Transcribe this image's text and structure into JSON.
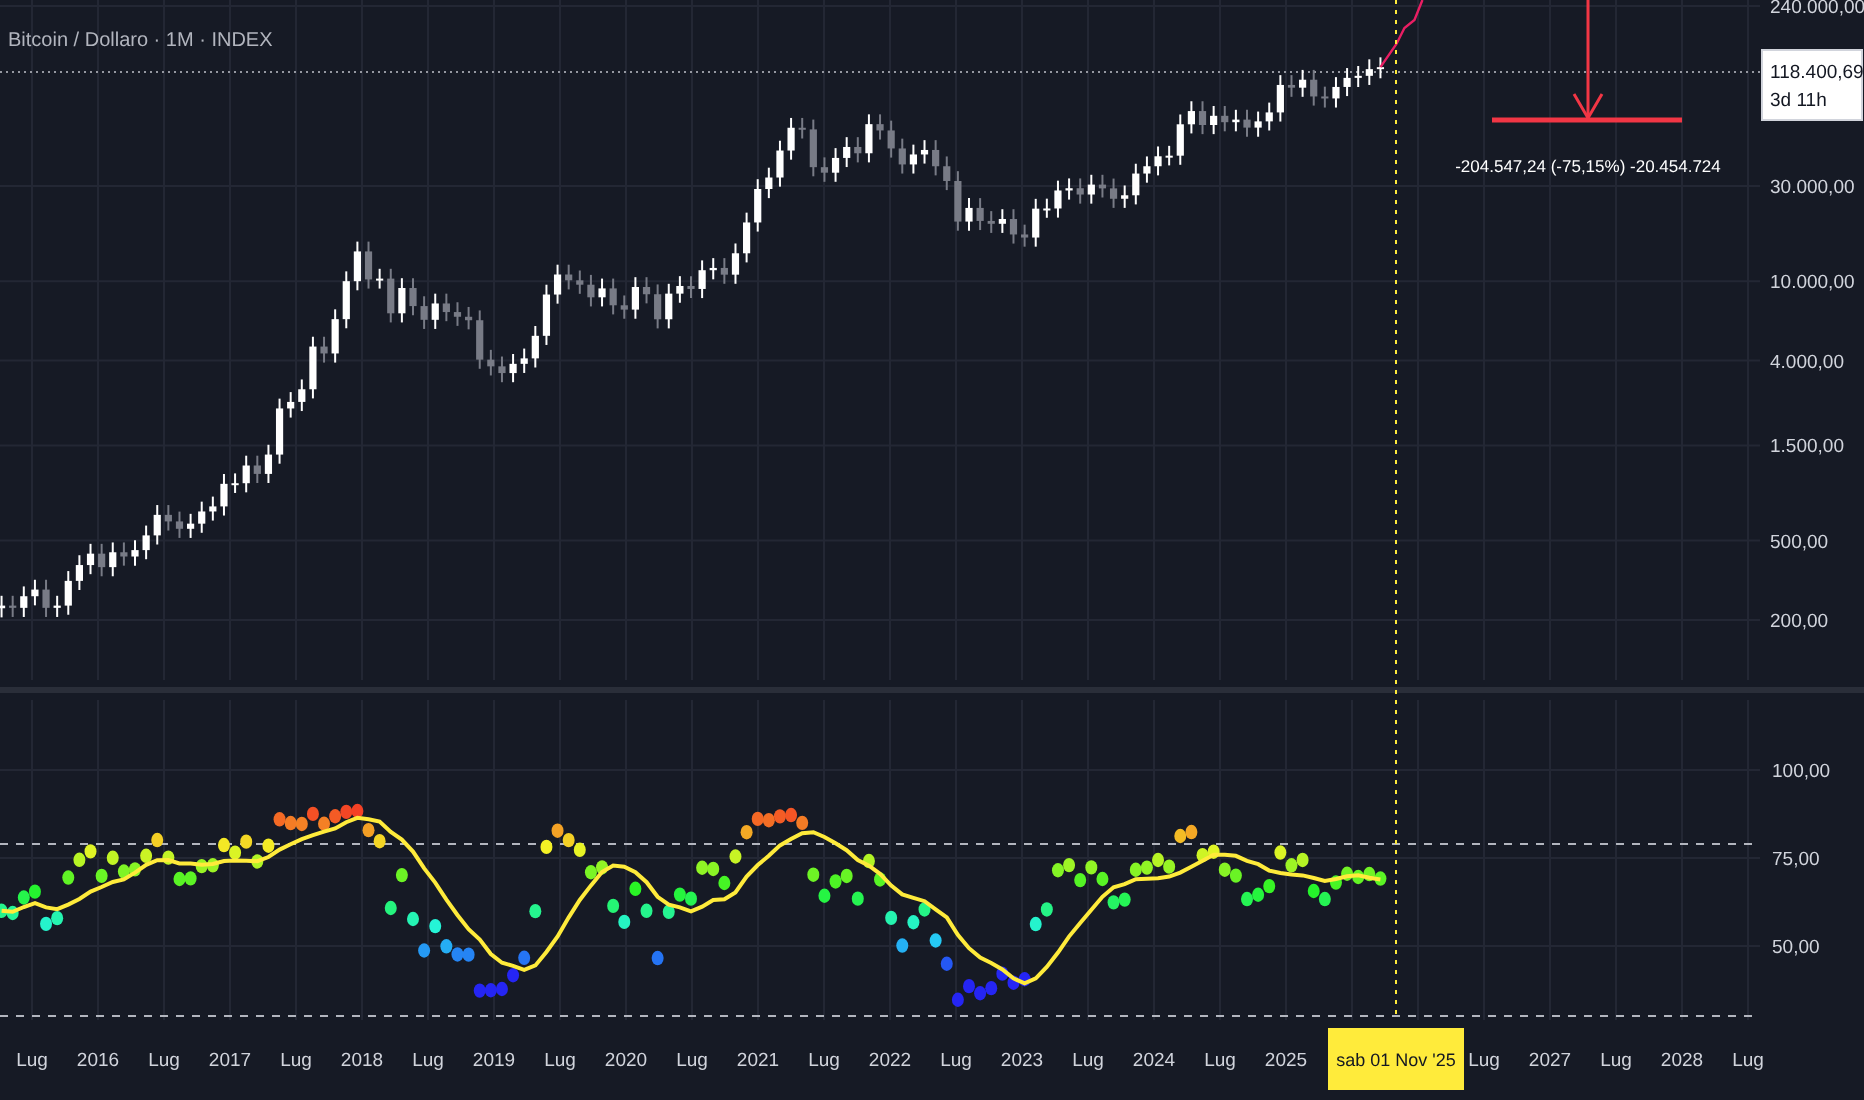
{
  "chart": {
    "title": "Bitcoin / Dollaro · 1M · INDEX",
    "price_axis": {
      "labels": [
        "240.000,00",
        "30.000,00",
        "10.000,00",
        "4.000,00",
        "1.500,00",
        "500,00",
        "200,00"
      ]
    },
    "last_price": {
      "value": "118.400,69",
      "countdown": "3d 11h"
    },
    "measure_label": "-204.547,24 (-75,15%) -20.454.724",
    "oscillator_axis": {
      "labels": [
        "100,00",
        "75,00",
        "50,00"
      ]
    },
    "time_axis": {
      "labels": [
        {
          "kind": "tick",
          "text": "Lug"
        },
        {
          "kind": "tick",
          "text": "2016"
        },
        {
          "kind": "tick",
          "text": "Lug"
        },
        {
          "kind": "tick",
          "text": "2017"
        },
        {
          "kind": "tick",
          "text": "Lug"
        },
        {
          "kind": "tick",
          "text": "2018"
        },
        {
          "kind": "tick",
          "text": "Lug"
        },
        {
          "kind": "tick",
          "text": "2019"
        },
        {
          "kind": "tick",
          "text": "Lug"
        },
        {
          "kind": "tick",
          "text": "2020"
        },
        {
          "kind": "tick",
          "text": "Lug"
        },
        {
          "kind": "tick",
          "text": "2021"
        },
        {
          "kind": "tick",
          "text": "Lug"
        },
        {
          "kind": "tick",
          "text": "2022"
        },
        {
          "kind": "tick",
          "text": "Lug"
        },
        {
          "kind": "tick",
          "text": "2023"
        },
        {
          "kind": "tick",
          "text": "Lug"
        },
        {
          "kind": "tick",
          "text": "2024"
        },
        {
          "kind": "tick",
          "text": "Lug"
        },
        {
          "kind": "tick",
          "text": "2025"
        },
        {
          "kind": "cursor",
          "text": "sab 01 Nov '25"
        },
        {
          "kind": "tick",
          "text": "Lug"
        },
        {
          "kind": "tick",
          "text": "2027"
        },
        {
          "kind": "tick",
          "text": "Lug"
        },
        {
          "kind": "tick",
          "text": "2028"
        },
        {
          "kind": "tick",
          "text": "Lug"
        }
      ]
    }
  }
}
